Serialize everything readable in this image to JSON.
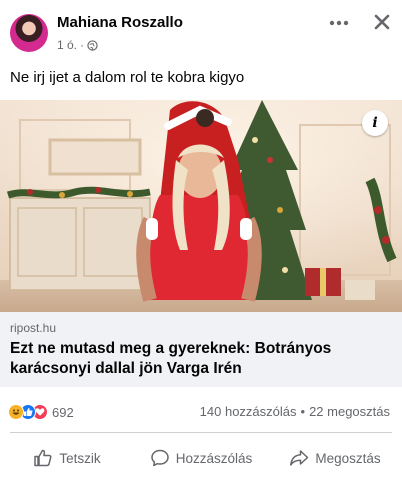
{
  "post": {
    "author": "Mahiana Roszallo",
    "time": "1 ó.",
    "separator": "·",
    "text": "Ne irj ijet a dalom rol te kobra kigyo"
  },
  "icons": {
    "avatar": "profile-photo",
    "privacy": "globe-icon",
    "more": "more-dots-icon",
    "close": "close-icon",
    "info": "info-icon",
    "like": "thumbs-up-icon",
    "comment": "comment-bubble-icon",
    "share": "share-arrow-icon"
  },
  "link": {
    "domain": "ripost.hu",
    "title": "Ezt ne mutasd meg a gyereknek: Botrányos karácsonyi dallal jön Varga Irén",
    "info_label": "i"
  },
  "stats": {
    "reaction_count": "692",
    "comments": "140 hozzászólás",
    "dot": "•",
    "shares": "22 megosztás"
  },
  "actions": {
    "like": "Tetszik",
    "comment": "Hozzászólás",
    "share": "Megosztás"
  },
  "colors": {
    "like_blue": "#1877f2",
    "love_red": "#f33e58",
    "haha_yellow": "#f7b125",
    "secondary_text": "#65676b",
    "link_bg": "#f0f2f5"
  }
}
